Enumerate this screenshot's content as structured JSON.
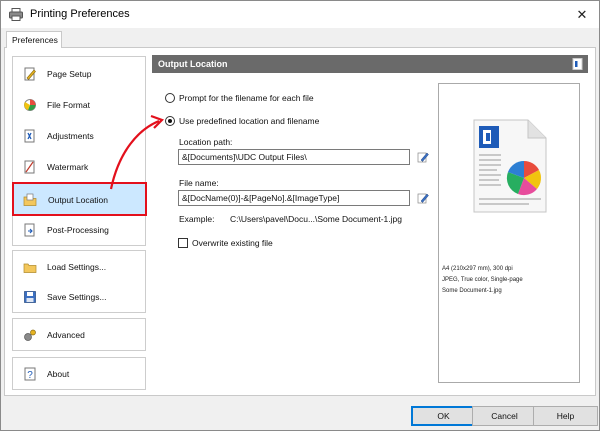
{
  "window": {
    "title": "Printing Preferences",
    "close_glyph": "✕"
  },
  "tabs": [
    {
      "label": "Preferences"
    }
  ],
  "sidebar": {
    "items": [
      {
        "label": "Page Setup",
        "icon": "page-setup-icon"
      },
      {
        "label": "File Format",
        "icon": "file-format-icon"
      },
      {
        "label": "Adjustments",
        "icon": "adjustments-icon"
      },
      {
        "label": "Watermark",
        "icon": "watermark-icon"
      },
      {
        "label": "Output Location",
        "icon": "output-location-icon",
        "selected": true
      },
      {
        "label": "Post-Processing",
        "icon": "post-processing-icon"
      },
      {
        "label": "Load Settings...",
        "icon": "load-settings-icon"
      },
      {
        "label": "Save Settings...",
        "icon": "save-settings-icon"
      },
      {
        "label": "Advanced",
        "icon": "advanced-icon"
      },
      {
        "label": "About",
        "icon": "about-icon"
      }
    ]
  },
  "content": {
    "header": "Output Location",
    "radio_prompt": "Prompt for the filename for each file",
    "radio_predefined": "Use predefined location and filename",
    "selected_option": "predefined",
    "location_label": "Location path:",
    "location_value": "&[Documents]\\UDC Output Files\\",
    "filename_label": "File name:",
    "filename_value": "&[DocName(0)]-&[PageNo].&[ImageType]",
    "example_label": "Example:",
    "example_value": "C:\\Users\\pavel\\Docu...\\Some Document-1.jpg",
    "overwrite_label": "Overwrite existing file",
    "overwrite_checked": false
  },
  "preview": {
    "line1": "A4 (210x297 mm), 300 dpi",
    "line2": "JPEG, True color, Single-page",
    "line3": "Some Document-1.jpg"
  },
  "buttons": {
    "ok": "OK",
    "cancel": "Cancel",
    "help": "Help"
  },
  "colors": {
    "selection_bg": "#cce8ff",
    "highlight_red": "#e3101c",
    "header_bg": "#6a6a6a",
    "default_button_border": "#0078d7"
  }
}
